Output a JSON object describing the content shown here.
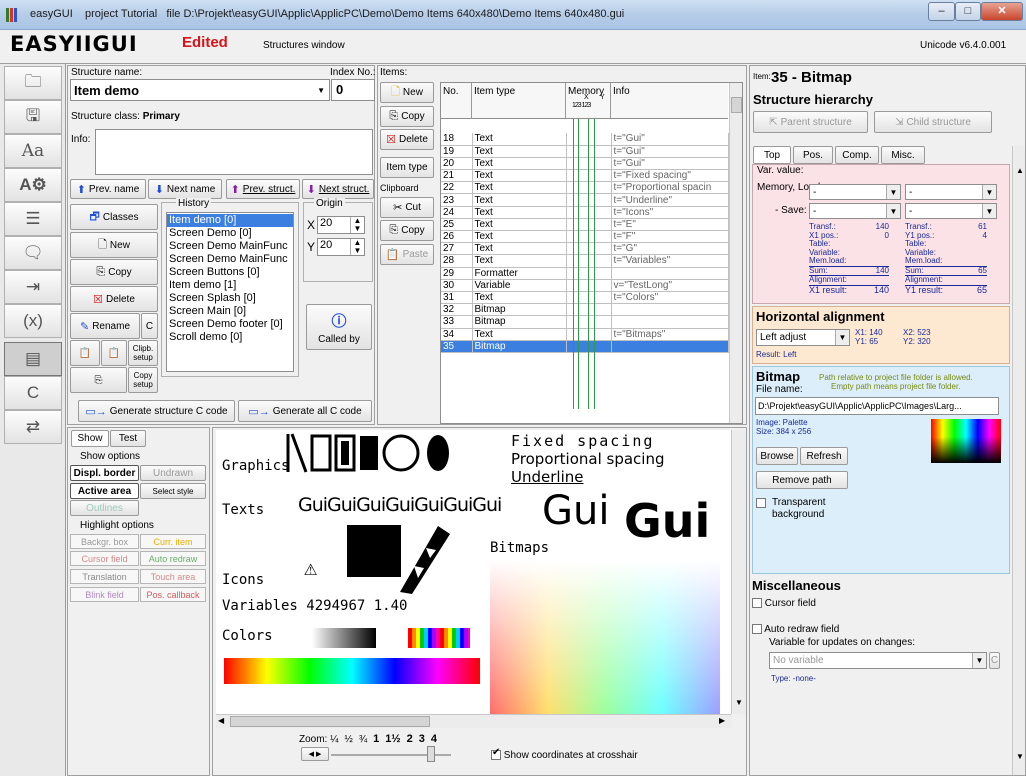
{
  "window": {
    "title": "easyGUI    project Tutorial   file D:\\Projekt\\easyGUI\\Applic\\ApplicPC\\Demo\\Demo Items 640x480\\Demo Items 640x480.gui",
    "min": "–",
    "max": "□",
    "close": "✕"
  },
  "header": {
    "logo": "EASYIIGUI",
    "edited": "Edited",
    "window_name": "Structures window",
    "version": "Unicode v6.4.0.001"
  },
  "structure": {
    "name_label": "Structure name:",
    "index_label": "Index No.:",
    "name": "Item demo",
    "index": "0",
    "class_label": "Structure class:",
    "class_value": "Primary",
    "info_label": "Info:",
    "prev_name": "Prev. name",
    "next_name": "Next name",
    "prev_struct": "Prev. struct.",
    "next_struct": "Next struct.",
    "history_label": "History",
    "origin_label": "Origin",
    "origin_x": "20",
    "origin_y": "20",
    "x": "X",
    "y": "Y",
    "history": [
      "Item demo [0]",
      "Screen Demo [0]",
      "Screen Demo MainFunc",
      "Screen Demo MainFunc",
      "Screen Buttons [0]",
      "Item demo [1]",
      "Screen Splash [0]",
      "Screen Main [0]",
      "Screen Demo footer [0]",
      "Scroll demo [0]"
    ],
    "classes": "Classes",
    "new": "New",
    "copy": "Copy",
    "delete": "Delete",
    "rename": "Rename",
    "c": "C",
    "clipb_setup": "Clipb. setup",
    "copy_setup": "Copy setup",
    "called_by": "Called by",
    "gen_c": "Generate structure C code",
    "gen_all": "Generate all C code"
  },
  "items": {
    "label": "Items:",
    "new": "New",
    "copy": "Copy",
    "delete": "Delete",
    "item_type_btn": "Item type",
    "clipboard_label": "Clipboard",
    "cut": "Cut",
    "copy2": "Copy",
    "paste": "Paste",
    "col_no": "No.",
    "col_type": "Item type",
    "col_memory": "Memory",
    "col_info": "Info",
    "mem_x": "X",
    "mem_y": "Y",
    "mem_digits": "123 123",
    "rows": [
      {
        "no": "18",
        "type": "Text",
        "info": "t=\"Gui\""
      },
      {
        "no": "19",
        "type": "Text",
        "info": "t=\"Gui\""
      },
      {
        "no": "20",
        "type": "Text",
        "info": "t=\"Gui\""
      },
      {
        "no": "21",
        "type": "Text",
        "info": "t=\"Fixed spacing\""
      },
      {
        "no": "22",
        "type": "Text",
        "info": "t=\"Proportional spacin"
      },
      {
        "no": "23",
        "type": "Text",
        "info": "t=\"Underline\""
      },
      {
        "no": "24",
        "type": "Text",
        "info": "t=\"Icons\""
      },
      {
        "no": "25",
        "type": "Text",
        "info": "t=\"E\""
      },
      {
        "no": "26",
        "type": "Text",
        "info": "t=\"F\""
      },
      {
        "no": "27",
        "type": "Text",
        "info": "t=\"G\""
      },
      {
        "no": "28",
        "type": "Text",
        "info": "t=\"Variables\""
      },
      {
        "no": "29",
        "type": "Formatter",
        "info": ""
      },
      {
        "no": "30",
        "type": "Variable",
        "info": "v=\"TestLong\""
      },
      {
        "no": "31",
        "type": "Text",
        "info": "t=\"Colors\""
      },
      {
        "no": "32",
        "type": "Bitmap",
        "info": ""
      },
      {
        "no": "33",
        "type": "Bitmap",
        "info": ""
      },
      {
        "no": "34",
        "type": "Text",
        "info": "t=\"Bitmaps\""
      },
      {
        "no": "35",
        "type": "Bitmap",
        "info": ""
      }
    ]
  },
  "right": {
    "item_label": "Item:",
    "item_title": "35 - Bitmap",
    "hierarchy": "Structure hierarchy",
    "parent": "Parent structure",
    "child": "Child structure",
    "tabs": [
      "Top",
      "Pos.",
      "Comp.",
      "Misc."
    ],
    "var_value": "Var. value:",
    "memory_load": "Memory, Load:",
    "save": "- Save:",
    "dash": "-",
    "transf": "Transf.:",
    "x1pos": "X1 pos.:",
    "y1pos": "Y1 pos.:",
    "table": "Table:",
    "variable": "Variable:",
    "memload": "Mem.load:",
    "sum": "Sum:",
    "alignment": "Alignment:",
    "x1result": "X1 result:",
    "y1result": "Y1 result:",
    "tx": "140",
    "x1v": "0",
    "sumx": "140",
    "resx": "140",
    "ty": "61",
    "y1v": "4",
    "sumy": "65",
    "resy": "65",
    "halign": "Horizontal alignment",
    "halign_val": "Left adjust",
    "x1": "X1: 140",
    "x2": "X2: 523",
    "y1": "Y1: 65",
    "y2": "Y2: 320",
    "result": "Result: Left",
    "bitmap": "Bitmap",
    "bitmap_note1": "Path relative to project file folder is allowed.",
    "bitmap_note2": "Empty path means project file folder.",
    "file_name": "File name:",
    "path": "D:\\Projekt\\easyGUI\\Applic\\ApplicPC\\Images\\Larg...",
    "image": "Image: Palette",
    "size": "Size:   384 x 256",
    "browse": "Browse",
    "refresh": "Refresh",
    "remove": "Remove path",
    "transparent": "Transparent background",
    "misc": "Miscellaneous",
    "cursor_field": "Cursor field",
    "auto_redraw": "Auto redraw field",
    "var_updates": "Variable for updates on changes:",
    "no_var": "No variable",
    "type": "Type:  -none-"
  },
  "show": {
    "tab_show": "Show",
    "tab_test": "Test",
    "show_options": "Show options",
    "displ_border": "Displ. border",
    "undrawn": "Undrawn",
    "active_area": "Active area",
    "select_style": "Select style",
    "outlines": "Outlines",
    "highlight": "Highlight options",
    "backgr": "Backgr. box",
    "curr_item": "Curr. item",
    "cursor_field": "Cursor field",
    "auto_redraw": "Auto redraw",
    "translation": "Translation",
    "touch_area": "Touch area",
    "blink_field": "Blink field",
    "pos_callback": "Pos. callback"
  },
  "preview": {
    "graphics": "Graphics",
    "texts": "Texts",
    "icons": "Icons",
    "variables": "Variables",
    "variable_value": "4294967 1.40",
    "colors": "Colors",
    "bitmaps": "Bitmaps",
    "fixed": "Fixed spacing",
    "proportional": "Proportional spacing",
    "underline": "Underline",
    "gui_small": "GuiGuiGuiGuiGuiGuiGui",
    "gui_big1": "Gui",
    "gui_big2": "Gui",
    "zoom_label": "Zoom:",
    "zoom_levels": [
      "¼",
      "½",
      "¾",
      "1",
      "1½",
      "2",
      "3",
      "4"
    ],
    "crosshair": "Show coordinates at crosshair"
  }
}
